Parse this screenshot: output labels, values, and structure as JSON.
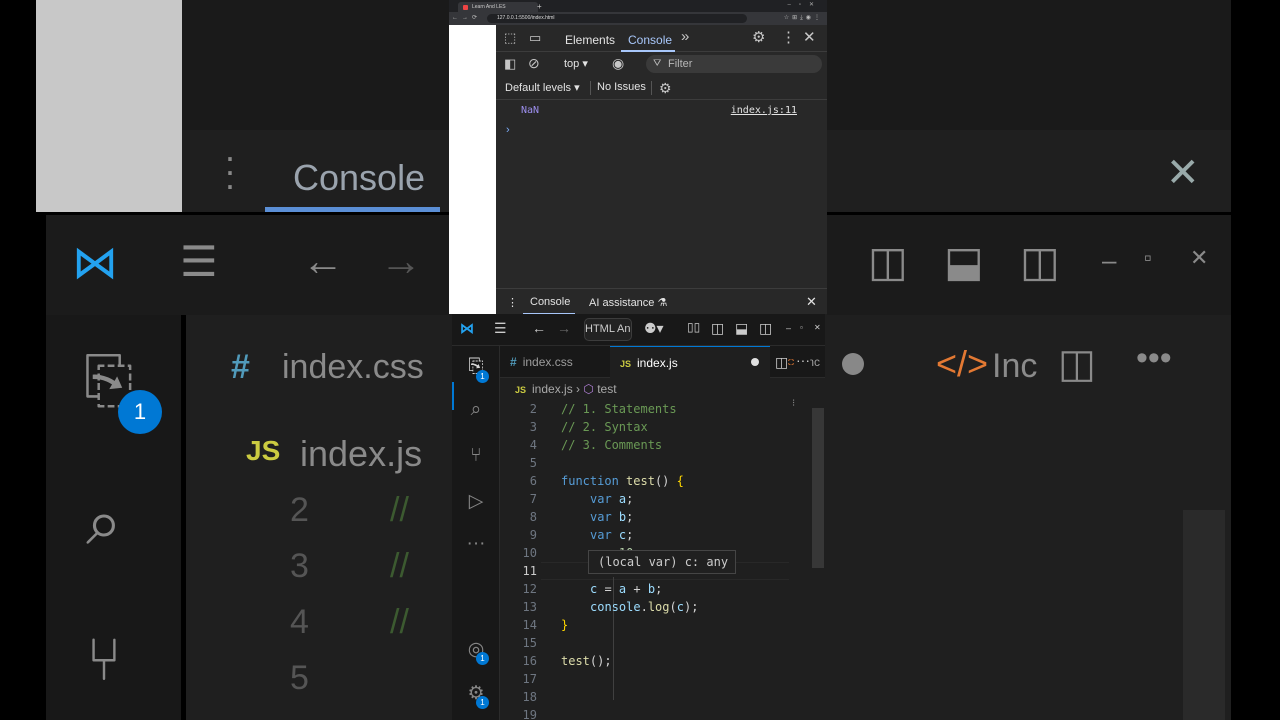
{
  "background": {
    "console_label": "Console",
    "tab_label_css": "index.css",
    "tab_label_js": "index.js",
    "tab_label_html": "Inc",
    "badge": "1",
    "gutter_numbers": [
      "2",
      "3",
      "4",
      "5"
    ],
    "comment_marks": [
      "//",
      "//",
      "//"
    ]
  },
  "browser": {
    "tab_title": "Learn And LES",
    "url": "127.0.0.1:5500/index.html",
    "new_tab": "+"
  },
  "devtools": {
    "tabs": [
      "Elements",
      "Console"
    ],
    "active_tab": "Console",
    "more_tabs_icon": "chevrons-right-icon",
    "context": "top",
    "filter_placeholder": "Filter",
    "default_levels": "Default levels",
    "no_issues": "No Issues",
    "log_value": "NaN",
    "log_source": "index.js:11",
    "prompt": "›",
    "drawer": {
      "tabs": [
        "Console",
        "AI assistance"
      ]
    }
  },
  "vscode": {
    "command_center": "HTML And",
    "tabs": [
      {
        "label": "index.css",
        "kind": "css"
      },
      {
        "label": "index.js",
        "kind": "js",
        "active": true,
        "modified": true
      },
      {
        "label": "Inc",
        "kind": "html"
      }
    ],
    "breadcrumb": {
      "file": "index.js",
      "symbol": "test"
    },
    "badges": {
      "explorer": "1",
      "accounts": "1",
      "settings": "1"
    },
    "current_line": "11",
    "hover_text": "(local var) c: any",
    "lines": [
      {
        "n": "2",
        "text": "// 1. Statements"
      },
      {
        "n": "3",
        "text": "// 2. Syntax"
      },
      {
        "n": "4",
        "text": "// 3. Comments"
      },
      {
        "n": "5",
        "text": ""
      },
      {
        "n": "6",
        "text": "function test() {"
      },
      {
        "n": "7",
        "text": "var a;"
      },
      {
        "n": "8",
        "text": "var b;"
      },
      {
        "n": "9",
        "text": "var c;"
      },
      {
        "n": "10",
        "text": "a = 10;"
      },
      {
        "n": "11",
        "text": ""
      },
      {
        "n": "12",
        "text": "c = a + b;"
      },
      {
        "n": "13",
        "text": "console.log(c);"
      },
      {
        "n": "14",
        "text": "}"
      },
      {
        "n": "15",
        "text": ""
      },
      {
        "n": "16",
        "text": "test();"
      },
      {
        "n": "17",
        "text": ""
      },
      {
        "n": "18",
        "text": ""
      },
      {
        "n": "19",
        "text": ""
      }
    ]
  },
  "colors": {
    "accent": "#0078d4",
    "console_tab_active": "#a8c7fa",
    "nan": "#9d8fef",
    "comment": "#6a9955",
    "keyword": "#569cd6",
    "function": "#dcdcaa"
  }
}
